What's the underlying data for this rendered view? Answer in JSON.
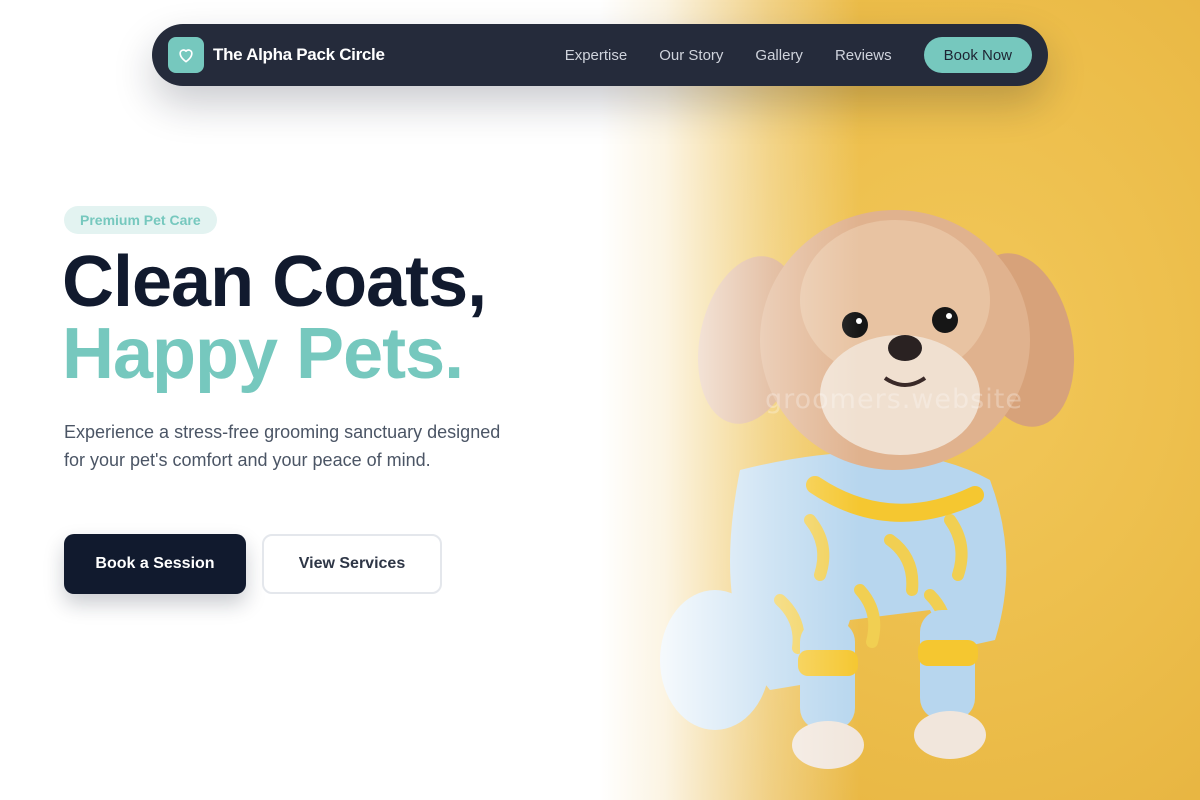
{
  "navbar": {
    "brand_name": "The Alpha Pack Circle",
    "brand_icon": "heart-icon",
    "links": [
      "Expertise",
      "Our Story",
      "Gallery",
      "Reviews"
    ],
    "cta_label": "Book Now"
  },
  "hero": {
    "badge": "Premium Pet Care",
    "headline_line1": "Clean Coats,",
    "headline_line2": "Happy Pets.",
    "description": "Experience a stress-free grooming sanctuary designed for your pet's comfort and your peace of mind.",
    "primary_button": "Book a Session",
    "secondary_button": "View Services",
    "image_watermark": "groomers.website"
  },
  "colors": {
    "accent": "#76c8be",
    "dark": "#111a2e",
    "navbar_bg": "#252b3b",
    "photo_background": "#ecbd4a"
  }
}
